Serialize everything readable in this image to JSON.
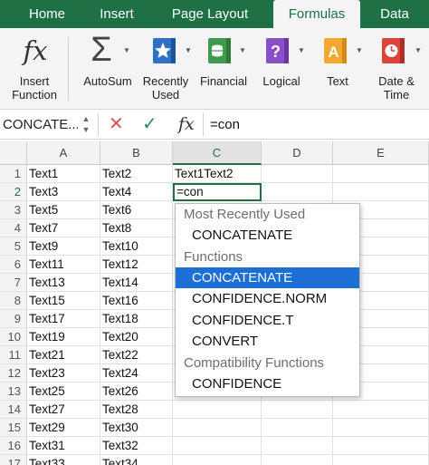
{
  "ribbon_tabs": [
    {
      "label": "Home"
    },
    {
      "label": "Insert"
    },
    {
      "label": "Page Layout"
    },
    {
      "label": "Formulas",
      "active": true
    },
    {
      "label": "Data"
    }
  ],
  "ribbon_buttons": {
    "insert_function": {
      "line1": "Insert",
      "line2": "Function",
      "icon": "fx-icon"
    },
    "autosum": {
      "line1": "AutoSum",
      "icon": "sigma-icon"
    },
    "recently_used": {
      "line1": "Recently",
      "line2": "Used",
      "icon": "star-icon"
    },
    "financial": {
      "line1": "Financial",
      "icon": "money-icon"
    },
    "logical": {
      "line1": "Logical",
      "icon": "question-icon"
    },
    "text": {
      "line1": "Text",
      "icon": "text-a-icon"
    },
    "date_time": {
      "line1": "Date &",
      "line2": "Time",
      "icon": "clock-icon"
    }
  },
  "formula_bar": {
    "name_box": "CONCATE...",
    "cancel_glyph": "✕",
    "enter_glyph": "✓",
    "fx_glyph": "fx",
    "value": "=con"
  },
  "grid": {
    "columns": [
      "A",
      "B",
      "C",
      "D",
      "E"
    ],
    "selected_column": "C",
    "selected_row": "2",
    "rows": [
      {
        "num": "1",
        "a": "Text1",
        "b": "Text2",
        "c": "Text1Text2"
      },
      {
        "num": "2",
        "a": "Text3",
        "b": "Text4",
        "c": ""
      },
      {
        "num": "3",
        "a": "Text5",
        "b": "Text6",
        "c": ""
      },
      {
        "num": "4",
        "a": "Text7",
        "b": "Text8",
        "c": ""
      },
      {
        "num": "5",
        "a": "Text9",
        "b": "Text10",
        "c": ""
      },
      {
        "num": "6",
        "a": "Text11",
        "b": "Text12",
        "c": ""
      },
      {
        "num": "7",
        "a": "Text13",
        "b": "Text14",
        "c": ""
      },
      {
        "num": "8",
        "a": "Text15",
        "b": "Text16",
        "c": ""
      },
      {
        "num": "9",
        "a": "Text17",
        "b": "Text18",
        "c": ""
      },
      {
        "num": "10",
        "a": "Text19",
        "b": "Text20",
        "c": ""
      },
      {
        "num": "11",
        "a": "Text21",
        "b": "Text22",
        "c": ""
      },
      {
        "num": "12",
        "a": "Text23",
        "b": "Text24",
        "c": ""
      },
      {
        "num": "13",
        "a": "Text25",
        "b": "Text26",
        "c": ""
      },
      {
        "num": "14",
        "a": "Text27",
        "b": "Text28",
        "c": ""
      },
      {
        "num": "15",
        "a": "Text29",
        "b": "Text30",
        "c": ""
      },
      {
        "num": "16",
        "a": "Text31",
        "b": "Text32",
        "c": ""
      },
      {
        "num": "17",
        "a": "Text33",
        "b": "Text34",
        "c": ""
      }
    ],
    "active_cell_value": "=con"
  },
  "autocomplete": {
    "sections": [
      {
        "header": "Most Recently Used",
        "items": [
          "CONCATENATE"
        ]
      },
      {
        "header": "Functions",
        "items": [
          "CONCATENATE",
          "CONFIDENCE.NORM",
          "CONFIDENCE.T",
          "CONVERT"
        ]
      },
      {
        "header": "Compatibility Functions",
        "items": [
          "CONFIDENCE"
        ]
      }
    ],
    "selected_item": "CONCATENATE"
  },
  "colors": {
    "brand": "#1f7145",
    "selection": "#1d6fd6"
  }
}
